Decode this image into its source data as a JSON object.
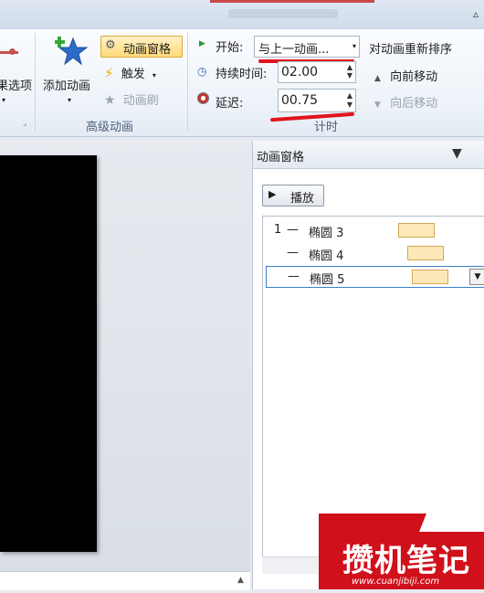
{
  "ribbon": {
    "left_cut_label": "果选项",
    "add_animation": "添加动画",
    "animation_pane_btn": "动画窗格",
    "trigger": "触发",
    "animation_painter": "动画刷",
    "advanced_group": "高级动画",
    "start_label": "开始:",
    "start_value": "与上一动画...",
    "duration_label": "持续时间:",
    "duration_value": "02.00",
    "delay_label": "延迟:",
    "delay_value": "00.75",
    "timing_group": "计时",
    "reorder_title": "对动画重新排序",
    "move_earlier": "向前移动",
    "move_later": "向后移动"
  },
  "pane": {
    "title": "动画窗格",
    "play": "播放",
    "items": [
      {
        "index": "1",
        "dash": "—",
        "name": "椭圆 3"
      },
      {
        "index": "",
        "dash": "—",
        "name": "椭圆 4"
      },
      {
        "index": "",
        "dash": "—",
        "name": "椭圆 5"
      }
    ]
  },
  "watermark": {
    "main": "攒机笔记",
    "url": "www.cuanjibiji.com"
  },
  "colors": {
    "accent_red": "#e0141e",
    "timeline_bar": "#fde9b8",
    "selection": "#3c7fc8"
  }
}
